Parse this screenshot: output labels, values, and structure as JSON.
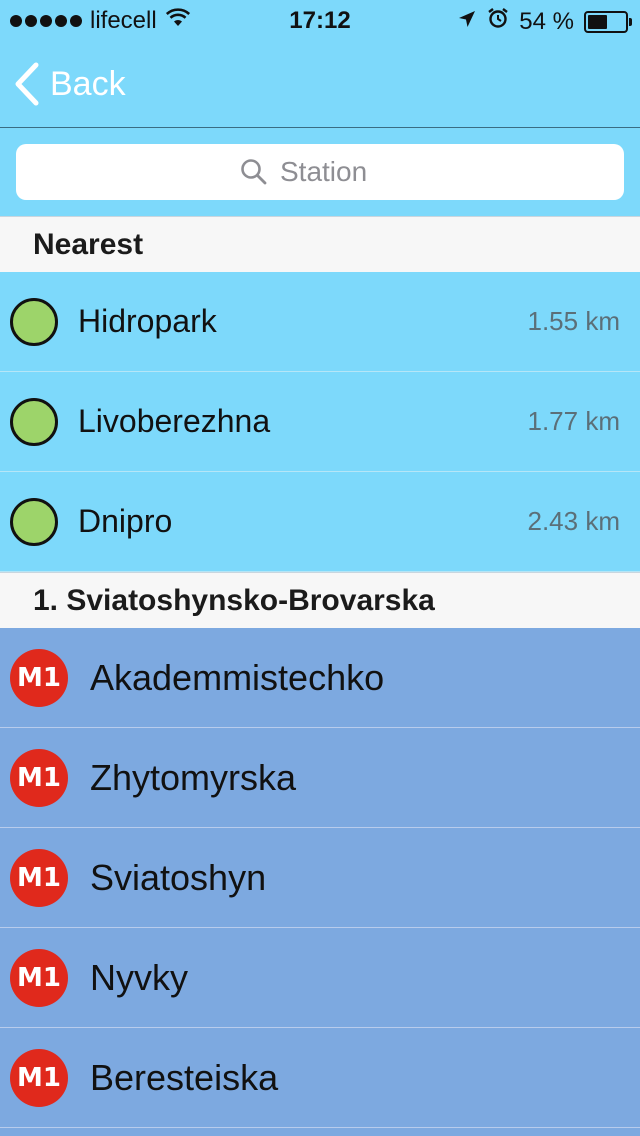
{
  "status_bar": {
    "carrier": "lifecell",
    "time": "17:12",
    "battery_percent_text": "54 %",
    "battery_level": 0.54,
    "signal_bars": 5
  },
  "nav": {
    "back_label": "Back"
  },
  "search": {
    "placeholder": "Station",
    "value": ""
  },
  "nearest": {
    "header": "Nearest",
    "items": [
      {
        "name": "Hidropark",
        "distance": "1.55 km"
      },
      {
        "name": "Livoberezhna",
        "distance": "1.77 km"
      },
      {
        "name": "Dnipro",
        "distance": "2.43 km"
      }
    ]
  },
  "line1": {
    "header": "1. Sviatoshynsko-Brovarska",
    "badge": "M1",
    "badge_color": "#e0291c",
    "items": [
      {
        "name": "Akademmistechko"
      },
      {
        "name": "Zhytomyrska"
      },
      {
        "name": "Sviatoshyn"
      },
      {
        "name": "Nyvky"
      },
      {
        "name": "Beresteiska"
      }
    ]
  },
  "colors": {
    "nav_background": "#7dd9fb",
    "line_row_background": "#7da9e0",
    "nearest_dot": "#9dd46a"
  }
}
